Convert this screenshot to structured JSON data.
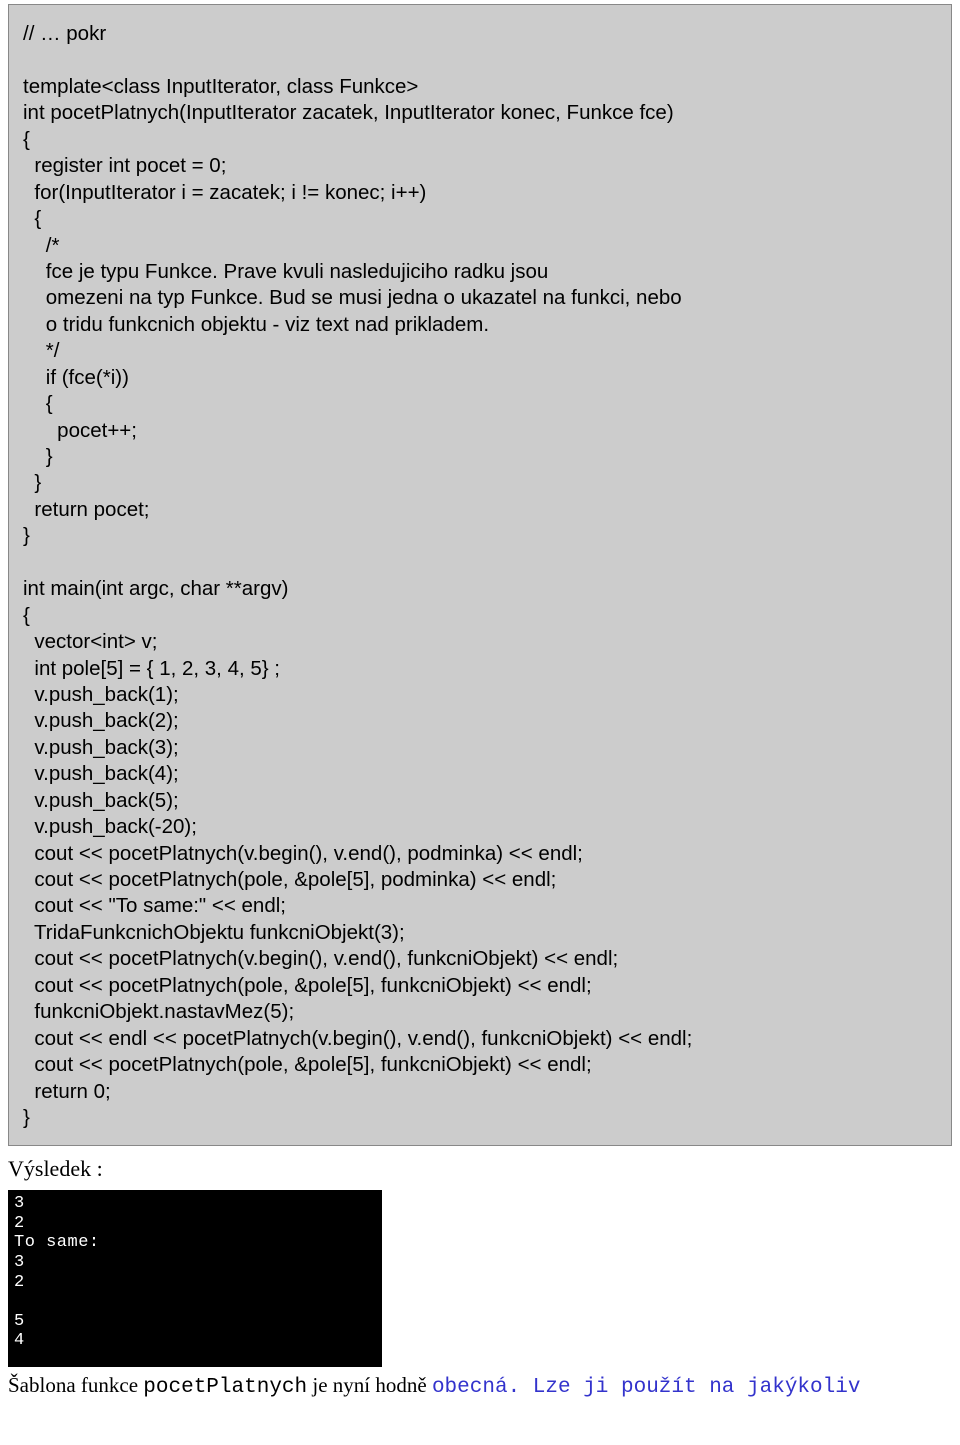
{
  "code_block": "// … pokr\n\ntemplate<class InputIterator, class Funkce>\nint pocetPlatnych(InputIterator zacatek, InputIterator konec, Funkce fce)\n{\n  register int pocet = 0;\n  for(InputIterator i = zacatek; i != konec; i++)\n  {\n    /*\n    fce je typu Funkce. Prave kvuli nasledujiciho radku jsou\n    omezeni na typ Funkce. Bud se musi jedna o ukazatel na funkci, nebo\n    o tridu funkcnich objektu - viz text nad prikladem.\n    */\n    if (fce(*i))\n    {\n      pocet++;\n    }\n  }\n  return pocet;\n}\n\nint main(int argc, char **argv)\n{\n  vector<int> v;\n  int pole[5] = { 1, 2, 3, 4, 5} ;\n  v.push_back(1);\n  v.push_back(2);\n  v.push_back(3);\n  v.push_back(4);\n  v.push_back(5);\n  v.push_back(-20);\n  cout << pocetPlatnych(v.begin(), v.end(), podminka) << endl;\n  cout << pocetPlatnych(pole, &pole[5], podminka) << endl;\n  cout << \"To same:\" << endl;\n  TridaFunkcnichObjektu funkcniObjekt(3);\n  cout << pocetPlatnych(v.begin(), v.end(), funkcniObjekt) << endl;\n  cout << pocetPlatnych(pole, &pole[5], funkcniObjekt) << endl;\n  funkcniObjekt.nastavMez(5);\n  cout << endl << pocetPlatnych(v.begin(), v.end(), funkcniObjekt) << endl;\n  cout << pocetPlatnych(pole, &pole[5], funkcniObjekt) << endl;\n  return 0;\n}",
  "result_label": "Výsledek :",
  "terminal_output": "3\n2\nTo same:\n3\n2\n\n5\n4",
  "footer": {
    "prefix": "Šablona funkce ",
    "mono1": "pocetPlatnych",
    "mid": " je nyní hodně ",
    "blue1": "obecná",
    "dot": ". ",
    "blue2": "Lze ji použít na jakýkoliv"
  }
}
